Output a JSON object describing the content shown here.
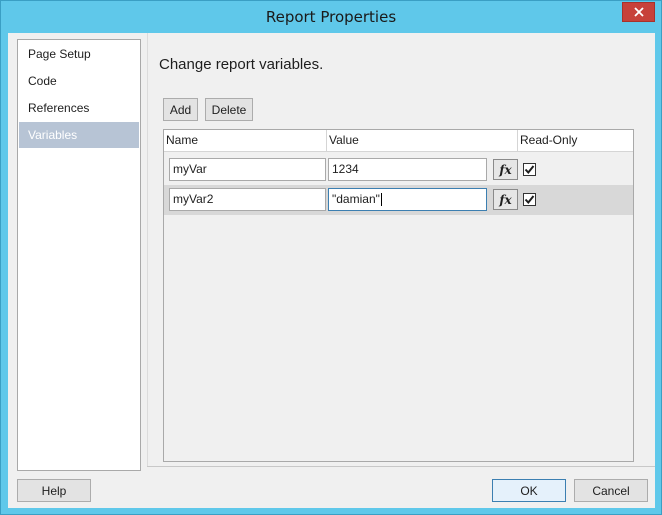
{
  "window": {
    "title": "Report Properties"
  },
  "nav": {
    "items": [
      {
        "label": "Page Setup",
        "selected": false
      },
      {
        "label": "Code",
        "selected": false
      },
      {
        "label": "References",
        "selected": false
      },
      {
        "label": "Variables",
        "selected": true
      }
    ]
  },
  "main": {
    "heading": "Change report variables.",
    "add_label": "Add",
    "delete_label": "Delete"
  },
  "grid": {
    "columns": [
      "Name",
      "Value",
      "Read-Only"
    ],
    "fx_label": "fx",
    "rows": [
      {
        "name": "myVar",
        "value": "1234",
        "read_only": true
      },
      {
        "name": "myVar2",
        "value": "\"damian\"",
        "read_only": true
      }
    ]
  },
  "footer": {
    "help_label": "Help",
    "ok_label": "OK",
    "cancel_label": "Cancel"
  },
  "colors": {
    "titlebar": "#5fc8ea",
    "close": "#c7413a",
    "selected_nav": "#b7c4d5"
  }
}
